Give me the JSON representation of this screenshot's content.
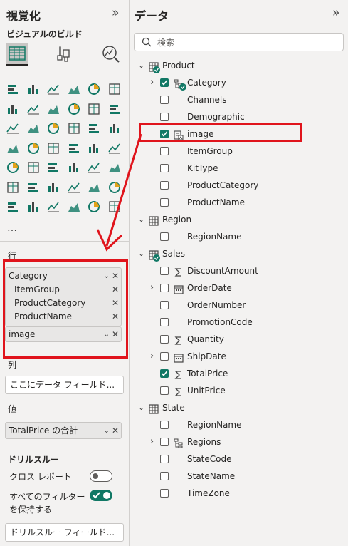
{
  "visualizations": {
    "title": "視覚化",
    "collapse_icon": "»",
    "subtitle": "ビジュアルのビルド",
    "more_label": "…",
    "wells": {
      "rows_title": "行",
      "rows_fields": [
        "Category",
        "ItemGroup",
        "ProductCategory",
        "ProductName"
      ],
      "rows_extra_field": "image",
      "columns_title": "列",
      "columns_placeholder": "ここにデータ フィールド...",
      "values_title": "値",
      "values_field": "TotalPrice の合計"
    },
    "drillthrough": {
      "title": "ドリルスルー",
      "cross_report_label": "クロス レポート",
      "cross_report_on": false,
      "keep_filters_label_1": "すべてのフィルター",
      "keep_filters_label_2": "を保持する",
      "keep_filters_on": true,
      "placeholder": "ドリルスルー フィールド..."
    }
  },
  "data_pane": {
    "title": "データ",
    "collapse_icon": "»",
    "search_placeholder": "検索",
    "accent_color": "#117865",
    "tree": [
      {
        "label": "Product",
        "level": 0,
        "kind": "table",
        "expanded": true,
        "badge": true
      },
      {
        "label": "Category",
        "level": 1,
        "kind": "hierarchy",
        "checked": true,
        "expander": true,
        "badge": true
      },
      {
        "label": "Channels",
        "level": 1,
        "kind": "none",
        "checked": false
      },
      {
        "label": "Demographic",
        "level": 1,
        "kind": "none",
        "checked": false
      },
      {
        "label": "image",
        "level": 1,
        "kind": "image",
        "checked": true
      },
      {
        "label": "ItemGroup",
        "level": 1,
        "kind": "none",
        "checked": false
      },
      {
        "label": "KitType",
        "level": 1,
        "kind": "none",
        "checked": false
      },
      {
        "label": "ProductCategory",
        "level": 1,
        "kind": "none",
        "checked": false
      },
      {
        "label": "ProductName",
        "level": 1,
        "kind": "none",
        "checked": false
      },
      {
        "label": "Region",
        "level": 0,
        "kind": "table",
        "expanded": true,
        "badge": false
      },
      {
        "label": "RegionName",
        "level": 1,
        "kind": "none",
        "checked": false
      },
      {
        "label": "Sales",
        "level": 0,
        "kind": "table",
        "expanded": true,
        "badge": true
      },
      {
        "label": "DiscountAmount",
        "level": 1,
        "kind": "sigma",
        "checked": false
      },
      {
        "label": "OrderDate",
        "level": 1,
        "kind": "calendar",
        "checked": false,
        "expander": true
      },
      {
        "label": "OrderNumber",
        "level": 1,
        "kind": "none",
        "checked": false
      },
      {
        "label": "PromotionCode",
        "level": 1,
        "kind": "none",
        "checked": false
      },
      {
        "label": "Quantity",
        "level": 1,
        "kind": "sigma",
        "checked": false
      },
      {
        "label": "ShipDate",
        "level": 1,
        "kind": "calendar",
        "checked": false,
        "expander": true
      },
      {
        "label": "TotalPrice",
        "level": 1,
        "kind": "sigma",
        "checked": true
      },
      {
        "label": "UnitPrice",
        "level": 1,
        "kind": "sigma",
        "checked": false
      },
      {
        "label": "State",
        "level": 0,
        "kind": "table",
        "expanded": true,
        "badge": false
      },
      {
        "label": "RegionName",
        "level": 1,
        "kind": "none",
        "checked": false
      },
      {
        "label": "Regions",
        "level": 1,
        "kind": "hierarchy",
        "checked": false,
        "expander": true
      },
      {
        "label": "StateCode",
        "level": 1,
        "kind": "none",
        "checked": false
      },
      {
        "label": "StateName",
        "level": 1,
        "kind": "none",
        "checked": false
      },
      {
        "label": "TimeZone",
        "level": 1,
        "kind": "none",
        "checked": false
      }
    ]
  },
  "annotation_color": "#e0141c"
}
